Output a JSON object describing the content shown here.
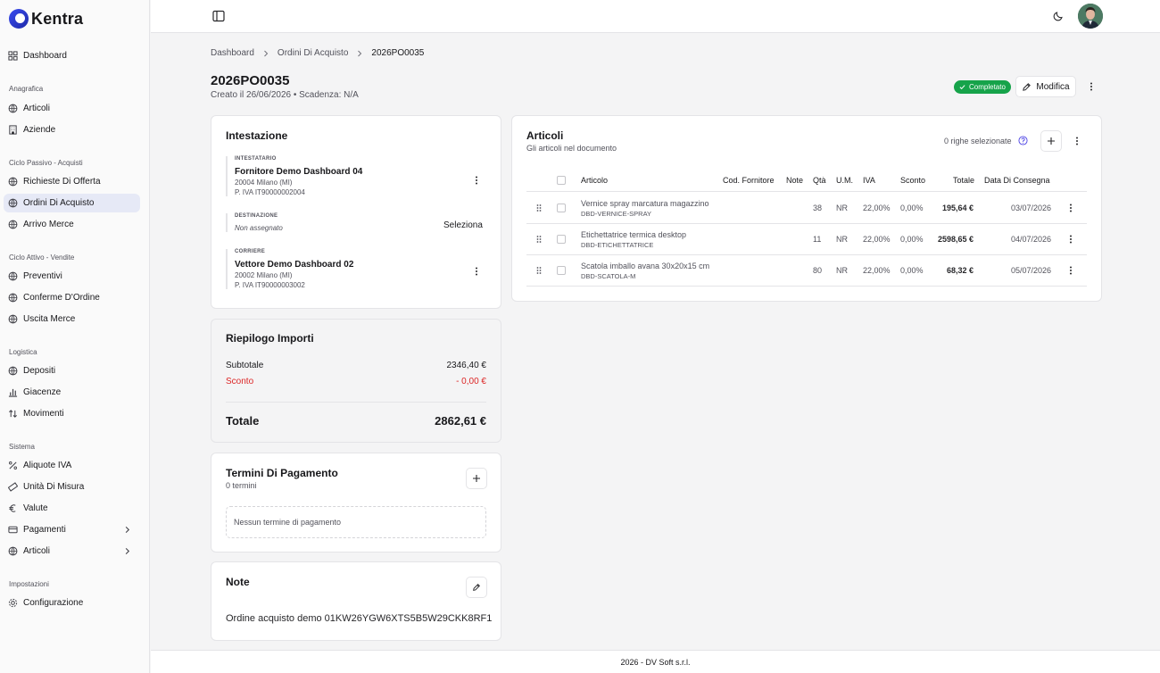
{
  "app": {
    "name": "Kentra"
  },
  "sidebar": {
    "dashboard": "Dashboard",
    "sections": {
      "anagrafica": "Anagrafica",
      "passivo": "Ciclo Passivo - Acquisti",
      "attivo": "Ciclo Attivo - Vendite",
      "logistica": "Logistica",
      "sistema": "Sistema",
      "impostazioni": "Impostazioni"
    },
    "items": {
      "articoli": "Articoli",
      "aziende": "Aziende",
      "richieste": "Richieste Di Offerta",
      "ordini": "Ordini Di Acquisto",
      "arrivo": "Arrivo Merce",
      "preventivi": "Preventivi",
      "conferme": "Conferme D'Ordine",
      "uscita": "Uscita Merce",
      "depositi": "Depositi",
      "giacenze": "Giacenze",
      "movimenti": "Movimenti",
      "aliquote": "Aliquote IVA",
      "unita": "Unità Di Misura",
      "valute": "Valute",
      "pagamenti": "Pagamenti",
      "articoli2": "Articoli",
      "configurazione": "Configurazione"
    },
    "active_color": "#e6e9f6"
  },
  "breadcrumb": [
    "Dashboard",
    "Ordini Di Acquisto",
    "2026PO0035"
  ],
  "page": {
    "title": "2026PO0035",
    "subtitle": "Creato il 26/06/2026 • Scadenza: N/A",
    "status": "Completato",
    "status_color": "#16a34a",
    "edit_label": "Modifica"
  },
  "intestazione": {
    "title": "Intestazione",
    "intestatario": {
      "label": "INTESTATARIO",
      "name": "Fornitore Demo Dashboard 04",
      "address": "20004 Milano (MI)",
      "vat": "P. IVA IT90000002004"
    },
    "destinazione": {
      "label": "DESTINAZIONE",
      "value": "Non assegnato",
      "action": "Seleziona"
    },
    "corriere": {
      "label": "CORRIERE",
      "name": "Vettore Demo Dashboard 02",
      "address": "20002 Milano (MI)",
      "vat": "P. IVA IT90000003002"
    }
  },
  "riepilogo": {
    "title": "Riepilogo Importi",
    "subtotale_label": "Subtotale",
    "subtotale": "2346,40 €",
    "sconto_label": "Sconto",
    "sconto": "- 0,00 €",
    "totale_label": "Totale",
    "totale": "2862,61 €"
  },
  "termini": {
    "title": "Termini Di Pagamento",
    "count": "0 termini",
    "empty": "Nessun termine di pagamento"
  },
  "note": {
    "title": "Note",
    "text": "Ordine acquisto demo 01KW26YGW6XTS5B5W29CKK8RF1"
  },
  "articoli": {
    "title": "Articoli",
    "subtitle": "Gli articoli nel documento",
    "selected": "0 righe selezionate",
    "columns": {
      "articolo": "Articolo",
      "cod": "Cod. Fornitore",
      "note": "Note",
      "qta": "Qtà",
      "um": "U.M.",
      "iva": "IVA",
      "sconto": "Sconto",
      "totale": "Totale",
      "data": "Data Di Consegna"
    },
    "rows": [
      {
        "desc": "Vernice spray marcatura magazzino",
        "code": "DBD-VERNICE-SPRAY",
        "qta": "38",
        "um": "NR",
        "iva": "22,00%",
        "sconto": "0,00%",
        "totale": "195,64 €",
        "data": "03/07/2026"
      },
      {
        "desc": "Etichettatrice termica desktop",
        "code": "DBD-ETICHETTATRICE",
        "qta": "11",
        "um": "NR",
        "iva": "22,00%",
        "sconto": "0,00%",
        "totale": "2598,65 €",
        "data": "04/07/2026"
      },
      {
        "desc": "Scatola imballo avana 30x20x15 cm",
        "code": "DBD-SCATOLA-M",
        "qta": "80",
        "um": "NR",
        "iva": "22,00%",
        "sconto": "0,00%",
        "totale": "68,32 €",
        "data": "05/07/2026"
      }
    ]
  },
  "footer": "2026 - DV Soft s.r.l."
}
